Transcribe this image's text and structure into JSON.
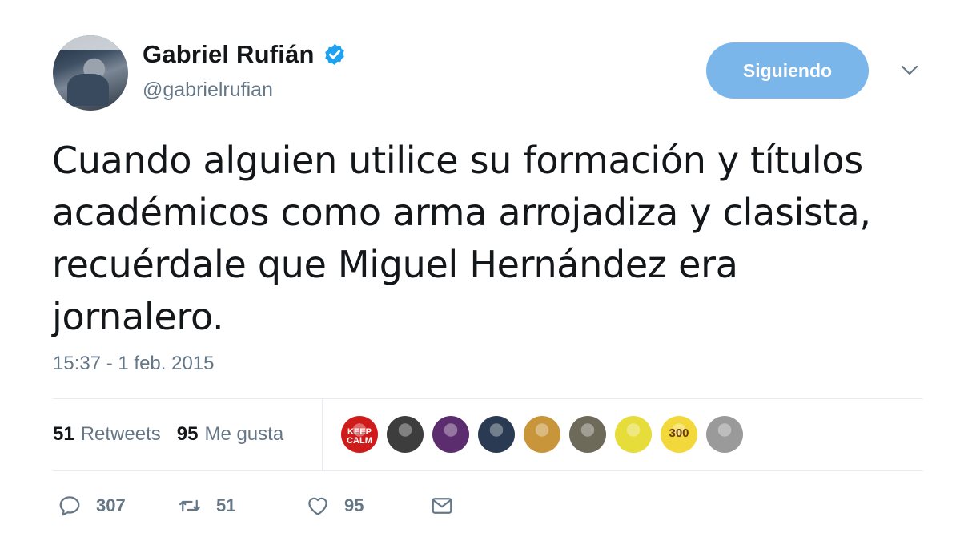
{
  "tweet": {
    "author": {
      "display_name": "Gabriel Rufián",
      "handle": "@gabrielrufian",
      "verified": true,
      "avatar_icon": "profile-photo"
    },
    "follow_button": "Siguiendo",
    "text": "Cuando alguien utilice su formación y títulos académicos como arma arrojadiza y clasista, recuérdale que Miguel Hernández era jornalero.",
    "timestamp": "15:37 - 1 feb. 2015",
    "stats": {
      "retweets_count": "51",
      "retweets_label": "Retweets",
      "likes_count": "95",
      "likes_label": "Me gusta"
    },
    "likers": [
      {
        "icon": "keep-calm-avatar",
        "color": "#d01b1b",
        "tag": "KEEP CALM"
      },
      {
        "icon": "user-avatar",
        "color": "#3d3d3d",
        "tag": ""
      },
      {
        "icon": "user-avatar",
        "color": "#5b2d6e",
        "tag": ""
      },
      {
        "icon": "user-avatar",
        "color": "#2a3a52",
        "tag": ""
      },
      {
        "icon": "vitruvian-avatar",
        "color": "#c8953a",
        "tag": ""
      },
      {
        "icon": "user-avatar",
        "color": "#6e6a5a",
        "tag": ""
      },
      {
        "icon": "user-avatar",
        "color": "#e6dc3a",
        "tag": ""
      },
      {
        "icon": "300-avatar",
        "color": "#f2d83a",
        "tag": "300"
      },
      {
        "icon": "user-avatar",
        "color": "#9a9a9a",
        "tag": ""
      }
    ],
    "actions": {
      "replies": "307",
      "retweets": "51",
      "likes": "95"
    },
    "colors": {
      "accent": "#1da1f2",
      "follow_bg": "#7ab6ea",
      "muted": "#657786"
    }
  }
}
